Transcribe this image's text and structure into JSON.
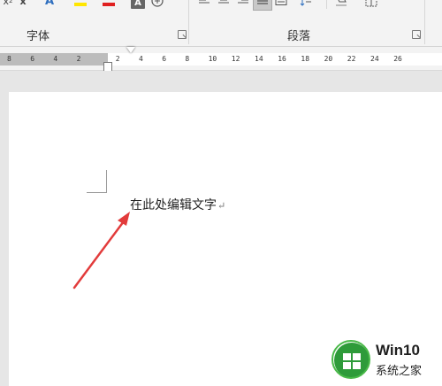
{
  "ribbon": {
    "font_group_label": "字体",
    "paragraph_group_label": "段落"
  },
  "ruler": {
    "ticks": [
      "8",
      "6",
      "4",
      "2",
      "2",
      "4",
      "6",
      "8",
      "10",
      "12",
      "14",
      "16",
      "18",
      "20",
      "22",
      "24",
      "26"
    ]
  },
  "document": {
    "text": "在此处编辑文字",
    "paragraph_mark": "↵"
  },
  "annotation": {
    "arrow_color": "#e23b3b"
  },
  "watermark": {
    "title": "Win10",
    "subtitle": "系统之家"
  }
}
